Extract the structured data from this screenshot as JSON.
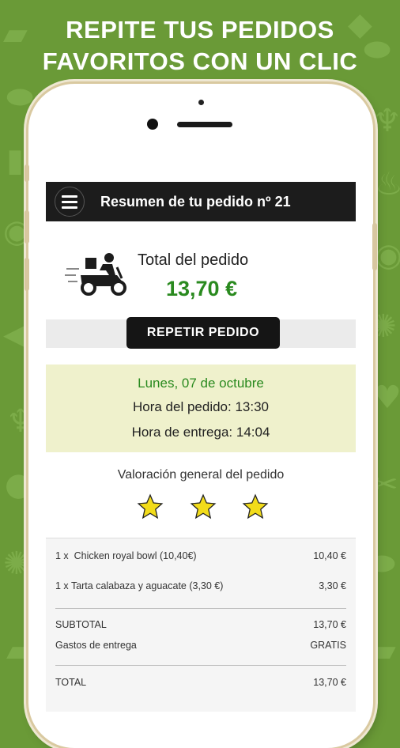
{
  "headline": {
    "line1": "REPITE TUS PEDIDOS",
    "line2": "FAVORITOS CON UN CLIC"
  },
  "appbar": {
    "title": "Resumen de tu pedido nº 21"
  },
  "summary": {
    "total_label": "Total del pedido",
    "total_value": "13,70 €",
    "repeat_button": "REPETIR PEDIDO"
  },
  "dates": {
    "date": "Lunes, 07 de octubre",
    "order_time": "Hora del pedido: 13:30",
    "delivery_time": "Hora de entrega: 14:04"
  },
  "rating": {
    "title": "Valoración general del pedido",
    "stars": 3
  },
  "items": [
    {
      "qty": "1 x",
      "name": "Chicken royal bowl (10,40€)",
      "price": "10,40 €"
    },
    {
      "qty": "1 x",
      "name": "Tarta calabaza y aguacate (3,30 €)",
      "price": "3,30 €"
    }
  ],
  "totals": {
    "subtotal_label": "SUBTOTAL",
    "subtotal_value": "13,70 €",
    "delivery_label": "Gastos de entrega",
    "delivery_value": "GRATIS",
    "total_label": "TOTAL",
    "total_value": "13,70 €"
  },
  "colors": {
    "background": "#6a9a37",
    "price_green": "#2a8a1f",
    "date_green": "#2a8a1f",
    "star": "#f2dc1a",
    "dates_panel": "#eff1cc"
  }
}
